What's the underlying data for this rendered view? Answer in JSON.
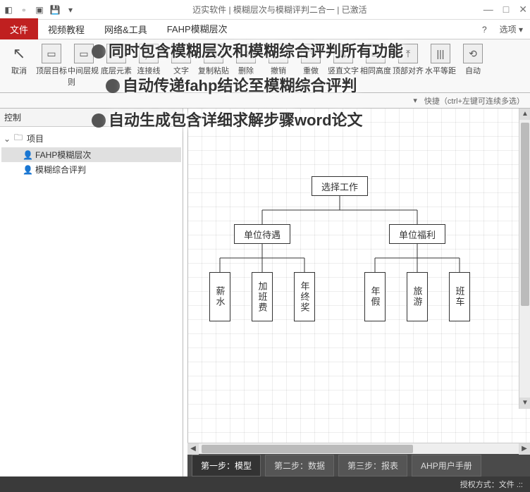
{
  "window": {
    "title": "迈实软件 | 模糊层次与模糊评判二合一 | 已激活",
    "min": "—",
    "max": "□",
    "close": "✕"
  },
  "menu": {
    "file": "文件",
    "tabs": [
      "视频教程",
      "网络&工具",
      "FAHP模糊层次"
    ],
    "active": 2,
    "help": "?",
    "options": "选项 ▾"
  },
  "ribbon": {
    "items": [
      {
        "label": "取消",
        "icon": "↖"
      },
      {
        "label": "顶层目标",
        "icon": "▭"
      },
      {
        "label": "中间层规则",
        "icon": "▭"
      },
      {
        "label": "底层元素",
        "icon": "▭"
      },
      {
        "label": "连接线",
        "icon": "╱"
      },
      {
        "label": "文字",
        "icon": "T"
      },
      {
        "label": "复制粘贴",
        "icon": "⧉"
      },
      {
        "label": "删除",
        "icon": "✕"
      },
      {
        "label": "撤销",
        "icon": "↶"
      },
      {
        "label": "重做",
        "icon": "↷"
      },
      {
        "label": "竖直文字",
        "icon": "⇅"
      },
      {
        "label": "相同高度",
        "icon": "▭"
      },
      {
        "label": "顶部对齐",
        "icon": "⤒"
      },
      {
        "label": "水平等距",
        "icon": "|||"
      },
      {
        "label": "自动",
        "icon": "⟲"
      }
    ]
  },
  "quick": {
    "dd": "▾",
    "hint": "快捷（ctrl+左键可连续多选）"
  },
  "sidebar": {
    "header": "控制",
    "root": "项目",
    "children": [
      "FAHP模糊层次",
      "模糊综合评判"
    ],
    "selected": 0
  },
  "diagram": {
    "root": "选择工作",
    "mids": [
      "单位待遇",
      "单位福利"
    ],
    "leaves_left": [
      "薪水",
      "加班费",
      "年终奖"
    ],
    "leaves_right": [
      "年假",
      "旅游",
      "班车"
    ]
  },
  "steps": {
    "items": [
      "第一步：模型",
      "第二步：数据",
      "第三步：报表",
      "AHP用户手册"
    ],
    "active": 0
  },
  "status": {
    "text": "授权方式：文件  .::"
  },
  "promo": {
    "l1": "同时包含模糊层次和模糊综合评判所有功能",
    "l2": "自动传递fahp结论至模糊综合评判",
    "l3": "自动生成包含详细求解步骤word论文"
  }
}
